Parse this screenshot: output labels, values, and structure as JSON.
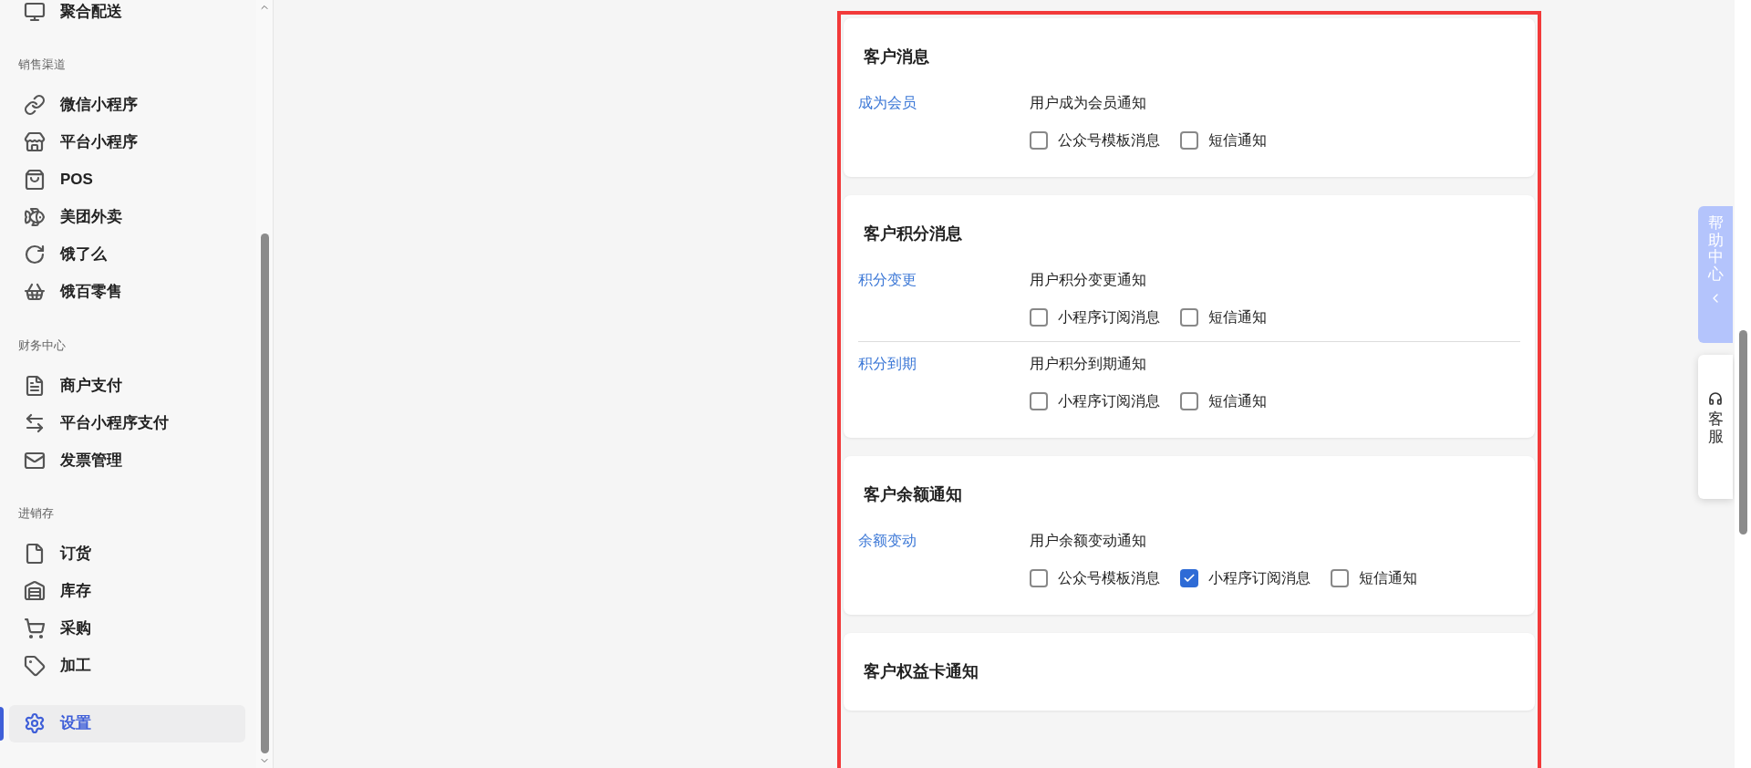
{
  "sidebar": {
    "sections": [
      {
        "items": [
          {
            "label": "聚合配送",
            "selected": false
          }
        ]
      },
      {
        "title": "销售渠道",
        "items": [
          {
            "label": "微信小程序",
            "selected": false
          },
          {
            "label": "平台小程序",
            "selected": false
          },
          {
            "label": "POS",
            "selected": false
          },
          {
            "label": "美团外卖",
            "selected": false
          },
          {
            "label": "饿了么",
            "selected": false
          },
          {
            "label": "饿百零售",
            "selected": false
          }
        ]
      },
      {
        "title": "财务中心",
        "items": [
          {
            "label": "商户支付",
            "selected": false
          },
          {
            "label": "平台小程序支付",
            "selected": false
          },
          {
            "label": "发票管理",
            "selected": false
          }
        ]
      },
      {
        "title": "进销存",
        "items": [
          {
            "label": "订货",
            "selected": false
          },
          {
            "label": "库存",
            "selected": false
          },
          {
            "label": "采购",
            "selected": false
          },
          {
            "label": "加工",
            "selected": false
          }
        ]
      },
      {
        "items": [
          {
            "label": "设置",
            "selected": true
          }
        ]
      }
    ]
  },
  "cards": [
    {
      "title": "客户消息",
      "rows": [
        {
          "name": "成为会员",
          "description": "用户成为会员通知",
          "options": [
            {
              "label": "公众号模板消息",
              "checked": false
            },
            {
              "label": "短信通知",
              "checked": false
            }
          ]
        }
      ]
    },
    {
      "title": "客户积分消息",
      "rows": [
        {
          "name": "积分变更",
          "description": "用户积分变更通知",
          "options": [
            {
              "label": "小程序订阅消息",
              "checked": false
            },
            {
              "label": "短信通知",
              "checked": false
            }
          ]
        },
        {
          "name": "积分到期",
          "description": "用户积分到期通知",
          "options": [
            {
              "label": "小程序订阅消息",
              "checked": false
            },
            {
              "label": "短信通知",
              "checked": false
            }
          ]
        }
      ]
    },
    {
      "title": "客户余额通知",
      "rows": [
        {
          "name": "余额变动",
          "description": "用户余额变动通知",
          "options": [
            {
              "label": "公众号模板消息",
              "checked": false
            },
            {
              "label": "小程序订阅消息",
              "checked": true
            },
            {
              "label": "短信通知",
              "checked": false
            }
          ]
        }
      ]
    },
    {
      "title": "客户权益卡通知"
    }
  ],
  "help_center": {
    "label": "帮助中心"
  },
  "customer_service": {
    "label": "客服"
  }
}
